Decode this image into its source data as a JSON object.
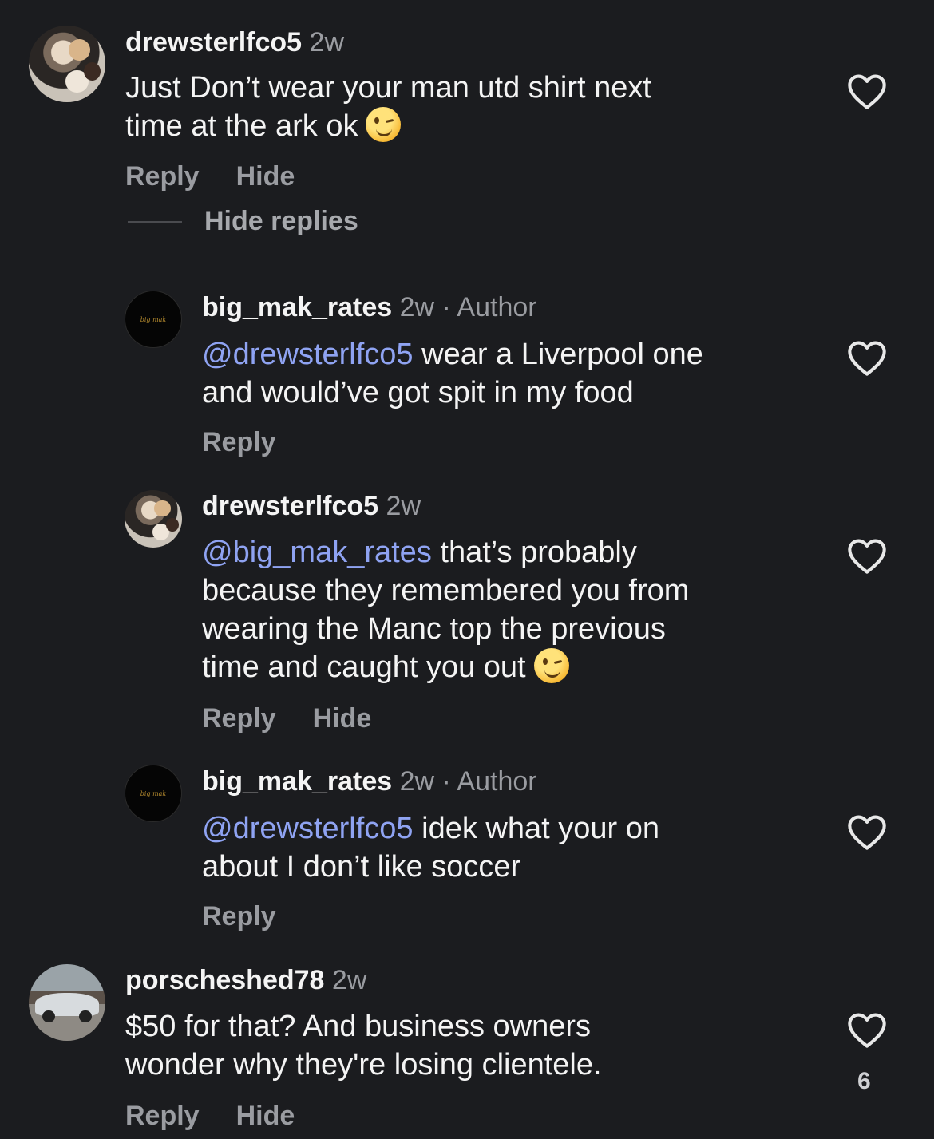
{
  "comments": [
    {
      "username": "drewsterlfco5",
      "time": "2w",
      "author_tag": "",
      "mention": "",
      "text_lines": [
        "Just Don’t wear your man utd shirt next",
        "time at the ark ok"
      ],
      "emoji": "winking-face",
      "actions": [
        "Reply",
        "Hide"
      ]
    },
    {
      "username": "big_mak_rates",
      "time": "2w",
      "author_tag": "· Author",
      "avatar_text": "big mak",
      "mention": "@drewsterlfco5",
      "text_lines": [
        " wear a Liverpool one",
        "and would’ve got spit in my food"
      ],
      "actions": [
        "Reply"
      ]
    },
    {
      "username": "drewsterlfco5",
      "time": "2w",
      "mention": "@big_mak_rates",
      "text_lines": [
        " that’s probably",
        "because they remembered you from",
        "wearing the Manc top the previous",
        "time and caught you out"
      ],
      "emoji": "winking-face",
      "actions": [
        "Reply",
        "Hide"
      ]
    },
    {
      "username": "big_mak_rates",
      "time": "2w",
      "author_tag": "· Author",
      "avatar_text": "big mak",
      "mention": "@drewsterlfco5",
      "text_lines": [
        " idek what your on",
        "about I don’t like soccer"
      ],
      "actions": [
        "Reply"
      ]
    },
    {
      "username": "porscheshed78",
      "time": "2w",
      "text_lines": [
        "$50 for that? And business owners",
        "wonder why they're losing clientele."
      ],
      "like_count": "6",
      "actions": [
        "Reply",
        "Hide"
      ]
    }
  ],
  "hide_replies_label": "Hide replies",
  "icons": {
    "like": "heart-outline-icon"
  },
  "colors": {
    "background": "#1b1c1f",
    "mention": "#8fa3f2",
    "meta": "#9a9ca1"
  }
}
